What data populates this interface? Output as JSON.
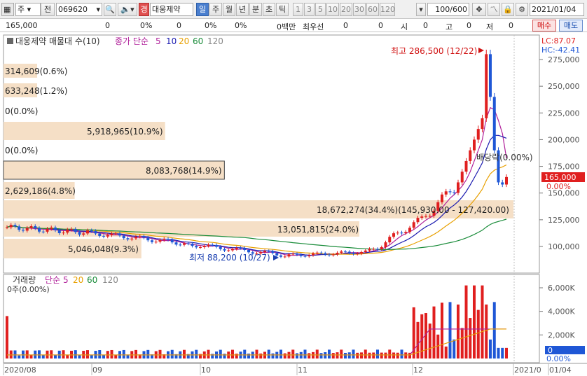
{
  "toolbar": {
    "type_label": "주",
    "prev_label": "전",
    "stock_code": "069620",
    "flag_label": "경",
    "stock_name": "대웅제약",
    "period_tabs": [
      "일",
      "주",
      "월",
      "년",
      "분",
      "초",
      "틱"
    ],
    "num_tabs": [
      "1",
      "3",
      "5",
      "10",
      "20",
      "30",
      "60",
      "120"
    ],
    "count": "100/600",
    "date": "2021/01/04"
  },
  "infobar": {
    "price": "165,000",
    "f1": "0",
    "f2": "0%",
    "f3": "0",
    "f4": "0%",
    "f5": "0%",
    "vol": "0백만",
    "best_label": "최우선",
    "best_v1": "0",
    "best_v2": "0",
    "open_label": "시",
    "open_val": "0",
    "high_label": "고",
    "high_val": "0",
    "low_label": "저",
    "low_val": "0",
    "buy_label": "매수",
    "sell_label": "매도"
  },
  "price_panel": {
    "title": "대웅제약 매물대 수(10)",
    "ma_label": "종가 단순",
    "ma_periods": [
      "5",
      "10",
      "20",
      "60",
      "120"
    ],
    "ma_colors": [
      "#b0209a",
      "#1b1bb0",
      "#e8a000",
      "#1a8c3a",
      "#888888"
    ],
    "lc": "LC:87.07",
    "hc": "HC:-42.41",
    "y_ticks": [
      "275,000",
      "250,000",
      "225,000",
      "200,000",
      "175,000",
      "150,000",
      "125,000",
      "100,000"
    ],
    "current_price": "165,000",
    "current_pct": "0.00%",
    "high_note": "최고 286,500 (12/22)",
    "low_note": "최저 88,200 (10/27)",
    "div_note": "배당락(0.00%)",
    "volume_profile": [
      {
        "label": "314,609(0.6%)",
        "pct": 0.6
      },
      {
        "label": "633,248(1.2%)",
        "pct": 1.2
      },
      {
        "label": "0(0.0%)",
        "pct": 0
      },
      {
        "label": "5,918,965(10.9%)",
        "pct": 10.9
      },
      {
        "label": "0(0.0%)",
        "pct": 0
      },
      {
        "label": "8,083,768(14.9%)",
        "pct": 14.9
      },
      {
        "label": "2,629,186(4.8%)",
        "pct": 4.8
      },
      {
        "label": "18,672,274(34.4%)(145,930.00 - 127,420.00)",
        "pct": 34.4
      },
      {
        "label": "13,051,815(24.0%)",
        "pct": 24.0
      },
      {
        "label": "5,046,048(9.3%)",
        "pct": 9.3
      }
    ]
  },
  "volume_panel": {
    "title": "거래량",
    "ma_label": "단순",
    "ma_periods": [
      "5",
      "20",
      "60",
      "120"
    ],
    "zero_label": "0주(0.00%)",
    "y_ticks": [
      "6,000K",
      "4,000K",
      "2,000K"
    ],
    "current_val": "0",
    "current_pct": "0.00%"
  },
  "x_axis": {
    "labels": [
      "2020/08",
      "09",
      "10",
      "11",
      "12",
      "2021/0",
      "01/04"
    ]
  },
  "chart_data": {
    "type": "candlestick",
    "x": [
      "2020-08",
      "2020-09",
      "2020-10",
      "2020-11",
      "2020-12",
      "2021-01"
    ],
    "high": 286500,
    "high_date": "12/22",
    "low": 88200,
    "low_date": "10/27",
    "last_close": 165000,
    "ylim": [
      85000,
      290000
    ],
    "volume_ylim": [
      0,
      7000000
    ]
  }
}
